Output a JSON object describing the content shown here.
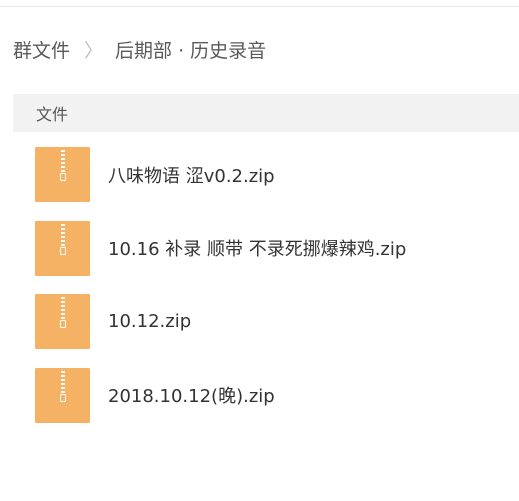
{
  "breadcrumb": {
    "root_label": "群文件",
    "separator": "〉",
    "current_label": "后期部 · 历史录音"
  },
  "table": {
    "column_header": "文件"
  },
  "files": [
    {
      "name": "八味物语 涩v0.2.zip",
      "icon": "zip-file-icon"
    },
    {
      "name": "10.16 补录 顺带 不录死挪爆辣鸡.zip",
      "icon": "zip-file-icon"
    },
    {
      "name": "10.12.zip",
      "icon": "zip-file-icon"
    },
    {
      "name": "2018.10.12(晚).zip",
      "icon": "zip-file-icon"
    }
  ],
  "colors": {
    "zip_icon": "#f6b264",
    "header_bg": "#f2f2f2",
    "text": "#333333"
  }
}
